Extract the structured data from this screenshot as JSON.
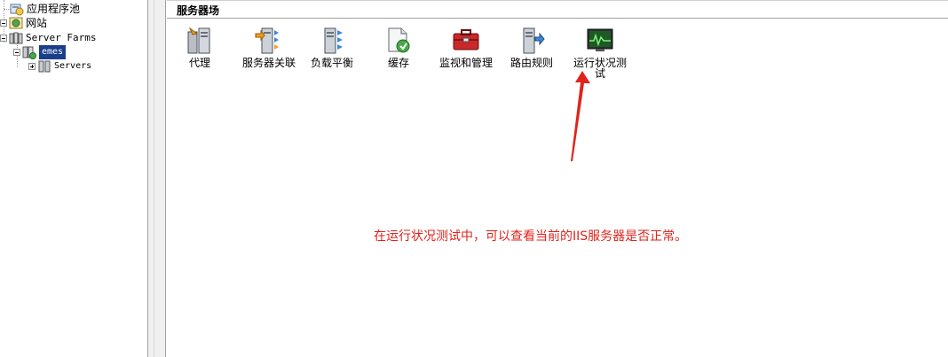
{
  "tree": {
    "items": [
      {
        "label": "应用程序池",
        "icon": "app-pool-icon"
      },
      {
        "label": "网站",
        "icon": "sites-icon"
      },
      {
        "label": "Server Farms",
        "icon": "server-farms-icon"
      },
      {
        "label": "emes",
        "icon": "server-farm-icon",
        "selected": true
      },
      {
        "label": "Servers",
        "icon": "servers-icon"
      }
    ]
  },
  "main": {
    "title": "服务器场",
    "features": [
      {
        "label": "代理",
        "icon": "proxy-icon"
      },
      {
        "label": "服务器关联",
        "icon": "server-affinity-icon"
      },
      {
        "label": "负载平衡",
        "icon": "load-balance-icon"
      },
      {
        "label": "缓存",
        "icon": "caching-icon"
      },
      {
        "label": "监视和管理",
        "icon": "monitoring-management-icon"
      },
      {
        "label": "路由规则",
        "icon": "routing-rules-icon"
      },
      {
        "label": "运行状况测试",
        "icon": "health-test-icon"
      }
    ]
  },
  "annotation": {
    "text": "在运行状况测试中，可以查看当前的IIS服务器是否正常。",
    "color": "#e0231c"
  },
  "colors": {
    "selection": "#1a3e8c",
    "annotation_red": "#e0231c"
  }
}
